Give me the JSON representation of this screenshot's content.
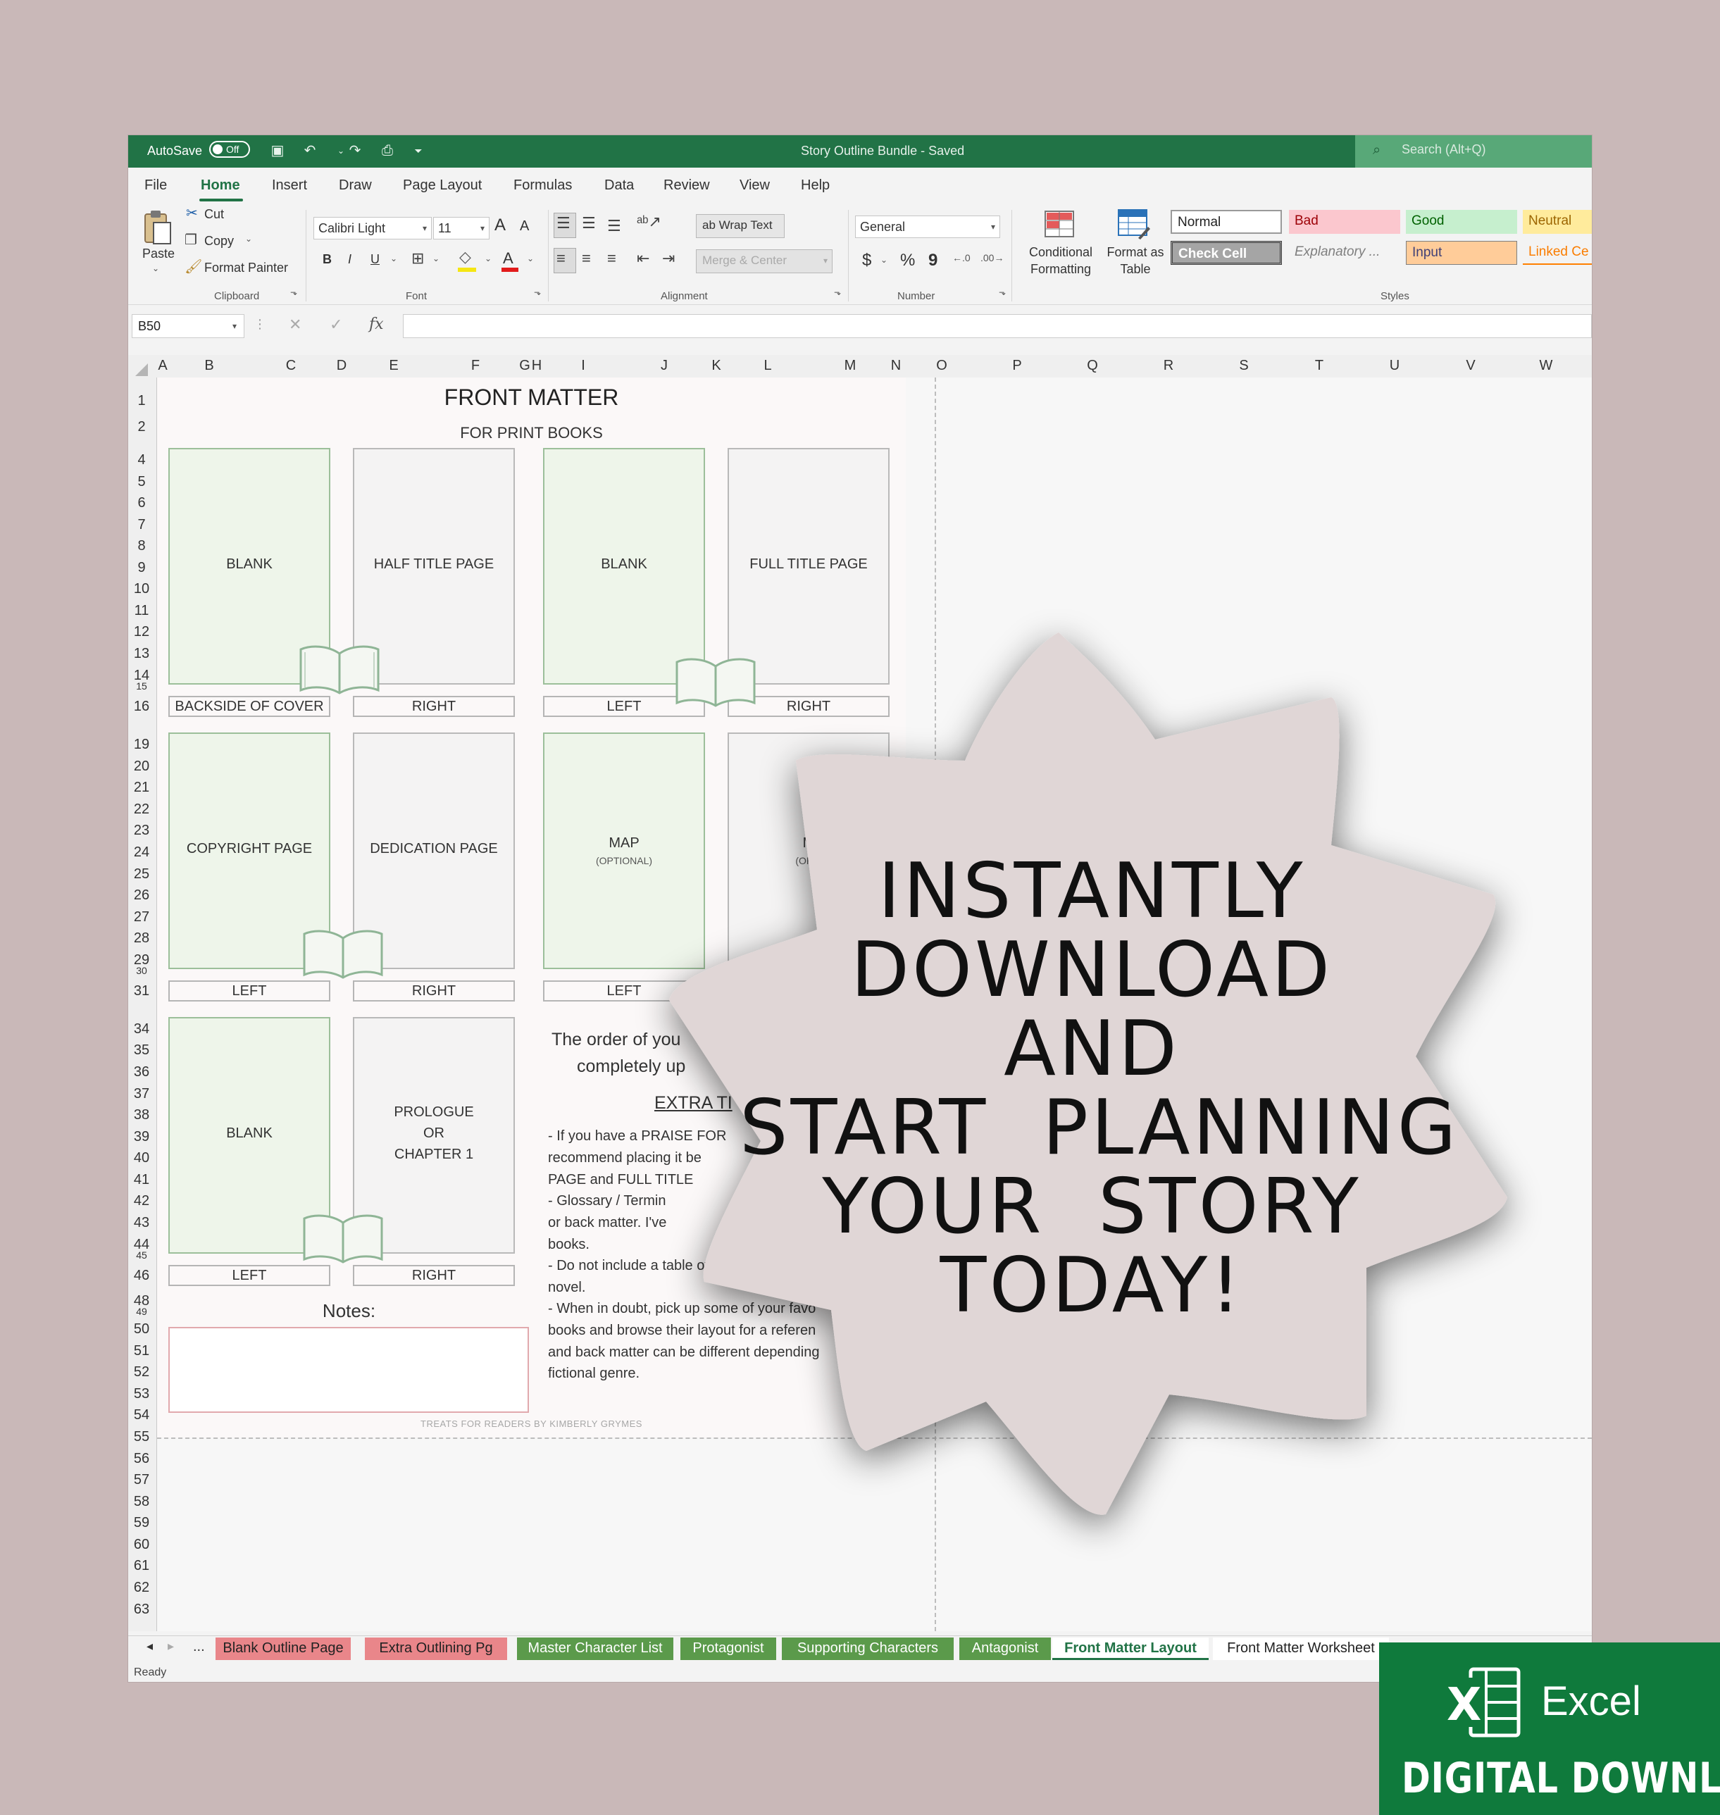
{
  "titlebar": {
    "autosave_label": "AutoSave",
    "autosave_state": "Off",
    "document": "Story Outline Bundle -  Saved",
    "search_placeholder": "Search (Alt+Q)"
  },
  "menu": [
    "File",
    "Home",
    "Insert",
    "Draw",
    "Page Layout",
    "Formulas",
    "Data",
    "Review",
    "View",
    "Help"
  ],
  "ribbon": {
    "clipboard": {
      "paste": "Paste",
      "cut": "Cut",
      "copy": "Copy",
      "format_painter": "Format Painter",
      "group": "Clipboard"
    },
    "font": {
      "name": "Calibri Light",
      "size": "11",
      "bold": "B",
      "italic": "I",
      "underline": "U",
      "group": "Font"
    },
    "alignment": {
      "wrap": "Wrap Text",
      "merge": "Merge & Center",
      "group": "Alignment"
    },
    "number": {
      "format": "General",
      "currency": "$",
      "percent": "%",
      "comma": "9",
      "group": "Number"
    },
    "conditional": "Conditional Formatting",
    "format_table": "Format as Table",
    "styles": {
      "group": "Styles",
      "items": [
        "Normal",
        "Bad",
        "Good",
        "Neutral",
        "Check Cell",
        "Explanatory ...",
        "Input",
        "Linked Ce"
      ]
    }
  },
  "formula_bar": {
    "name_box": "B50",
    "fx": "fx"
  },
  "columns": [
    "A",
    "B",
    "C",
    "D",
    "E",
    "F",
    "G",
    "H",
    "I",
    "J",
    "K",
    "L",
    "M",
    "N",
    "O",
    "P",
    "Q",
    "R",
    "S",
    "T",
    "U",
    "V",
    "W"
  ],
  "rows": [
    "1",
    "2",
    "4",
    "5",
    "6",
    "7",
    "8",
    "9",
    "10",
    "11",
    "12",
    "13",
    "14",
    "15",
    "16",
    "19",
    "20",
    "21",
    "22",
    "23",
    "24",
    "25",
    "26",
    "27",
    "28",
    "29",
    "30",
    "31",
    "34",
    "35",
    "36",
    "37",
    "38",
    "39",
    "40",
    "41",
    "42",
    "43",
    "44",
    "45",
    "46",
    "48",
    "49",
    "50",
    "51",
    "52",
    "53",
    "54",
    "55",
    "56",
    "57",
    "58",
    "59",
    "60",
    "61",
    "62",
    "63"
  ],
  "sheet": {
    "title": "FRONT MATTER",
    "subtitle": "FOR PRINT BOOKS",
    "pages": {
      "r1": [
        "BLANK",
        "HALF TITLE PAGE",
        "BLANK",
        "FULL TITLE PAGE"
      ],
      "r1_labels": [
        "BACKSIDE OF COVER",
        "RIGHT",
        "LEFT",
        "RIGHT"
      ],
      "r2": [
        "COPYRIGHT PAGE",
        "DEDICATION PAGE",
        "MAP",
        "M"
      ],
      "r2_sub": [
        "(OPTIONAL)",
        "(OPTI"
      ],
      "r2_labels": [
        "LEFT",
        "RIGHT",
        "LEFT"
      ],
      "r3": [
        "BLANK",
        "PROLOGUE",
        "OR",
        "CHAPTER 1"
      ],
      "r3_labels": [
        "LEFT",
        "RIGHT"
      ]
    },
    "order_line1": "The order of you",
    "order_line2": "completely up",
    "extra_heading": "EXTRA TI",
    "tips": [
      " - If you have a PRAISE FOR",
      "recommend placing it be",
      "PAGE and FULL TITLE",
      " - Glossary / Termin",
      "or back matter. I've",
      "books.",
      " - Do not include a table of contents in yo",
      "novel.",
      " - When in doubt, pick up some of your favo",
      "books and browse their layout for a referen",
      "and back matter can be different depending",
      "fictional genre."
    ],
    "notes_label": "Notes:",
    "credit": "TREATS FOR READERS BY KIMBERLY GRYMES"
  },
  "tabs": [
    {
      "label": "Blank Outline Page",
      "kind": "red"
    },
    {
      "label": "Extra Outlining Pg",
      "kind": "red"
    },
    {
      "label": "Master Character List",
      "kind": "green"
    },
    {
      "label": "Protagonist",
      "kind": "green"
    },
    {
      "label": "Supporting Characters",
      "kind": "green"
    },
    {
      "label": "Antagonist",
      "kind": "green"
    },
    {
      "label": "Front Matter Layout",
      "kind": "active"
    },
    {
      "label": "Front Matter Worksheet",
      "kind": "plain"
    }
  ],
  "tab_more": "...",
  "status": "Ready",
  "promo": {
    "lines": [
      "INSTANTLY",
      "DOWNLOAD",
      "AND",
      "START  PLANNING",
      "YOUR  STORY",
      "TODAY!"
    ],
    "fill": "#e0d6d6"
  },
  "badge": {
    "app": "Excel",
    "caption": "DIGITAL DOWNLOAD",
    "color": "#0f7a3c"
  }
}
